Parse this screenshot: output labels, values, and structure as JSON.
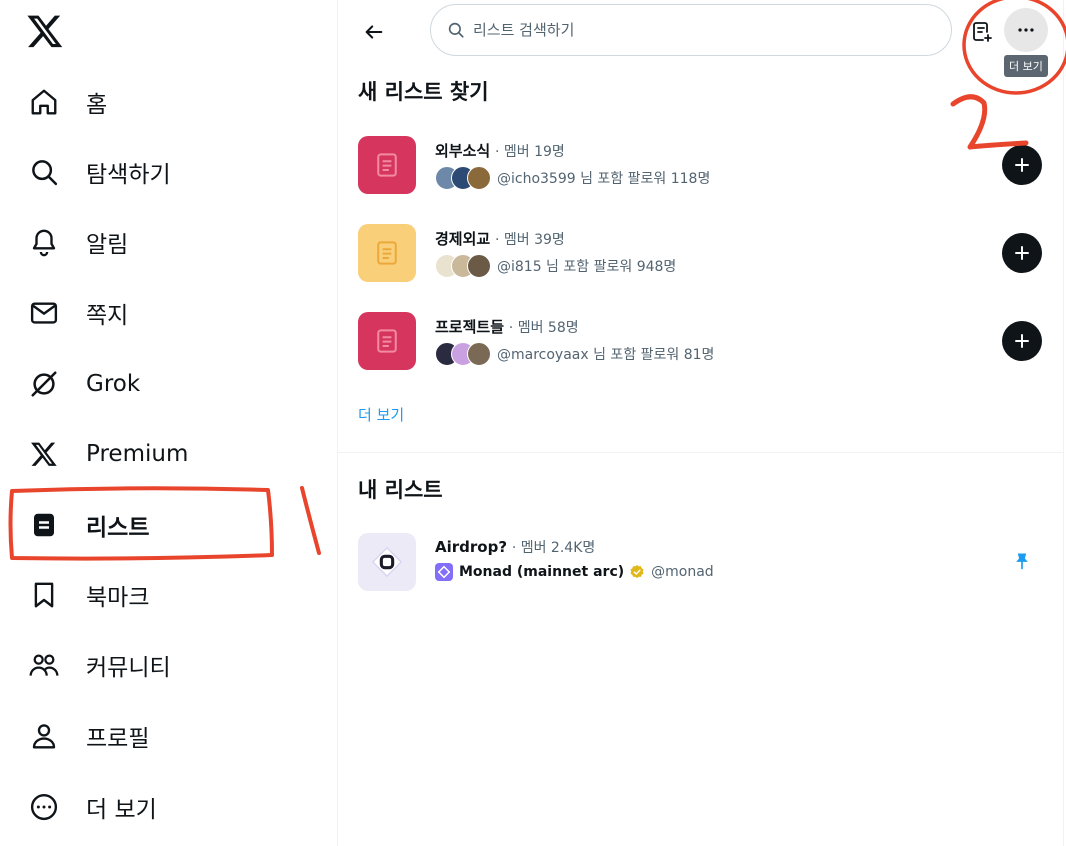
{
  "sidebar": {
    "logo_icon": "x-logo-icon",
    "items": [
      {
        "label": "홈",
        "icon": "home-icon"
      },
      {
        "label": "탐색하기",
        "icon": "search-icon"
      },
      {
        "label": "알림",
        "icon": "bell-icon"
      },
      {
        "label": "쪽지",
        "icon": "mail-icon"
      },
      {
        "label": "Grok",
        "icon": "grok-icon"
      },
      {
        "label": "Premium",
        "icon": "x-logo-icon"
      },
      {
        "label": "리스트",
        "icon": "list-icon",
        "active": true
      },
      {
        "label": "북마크",
        "icon": "bookmark-icon"
      },
      {
        "label": "커뮤니티",
        "icon": "community-icon"
      },
      {
        "label": "프로필",
        "icon": "profile-icon"
      },
      {
        "label": "더 보기",
        "icon": "more-circle-icon"
      }
    ]
  },
  "header": {
    "search_placeholder": "리스트 검색하기",
    "more_tooltip": "더 보기"
  },
  "discover": {
    "title": "새 리스트 찾기",
    "lists": [
      {
        "name": "외부소식",
        "members": "· 멤버 19명",
        "followers": "@icho3599 님 포함 팔로워 118명",
        "color": "#d6365d"
      },
      {
        "name": "경제외교",
        "members": "· 멤버 39명",
        "followers": "@i815 님 포함 팔로워 948명",
        "color": "#f9cf7a"
      },
      {
        "name": "프로젝트들",
        "members": "· 멤버 58명",
        "followers": "@marcoyaax 님 포함 팔로워 81명",
        "color": "#d6365d"
      }
    ],
    "show_more": "더 보기"
  },
  "my_lists": {
    "title": "내 리스트",
    "lists": [
      {
        "name": "Airdrop?",
        "members": "· 멤버 2.4K명",
        "owner_name": "Monad (mainnet arc)",
        "owner_handle": "@monad",
        "pinned": true
      }
    ]
  },
  "annotations": {
    "step1": "1",
    "step2": "2",
    "color": "#e8452c"
  }
}
